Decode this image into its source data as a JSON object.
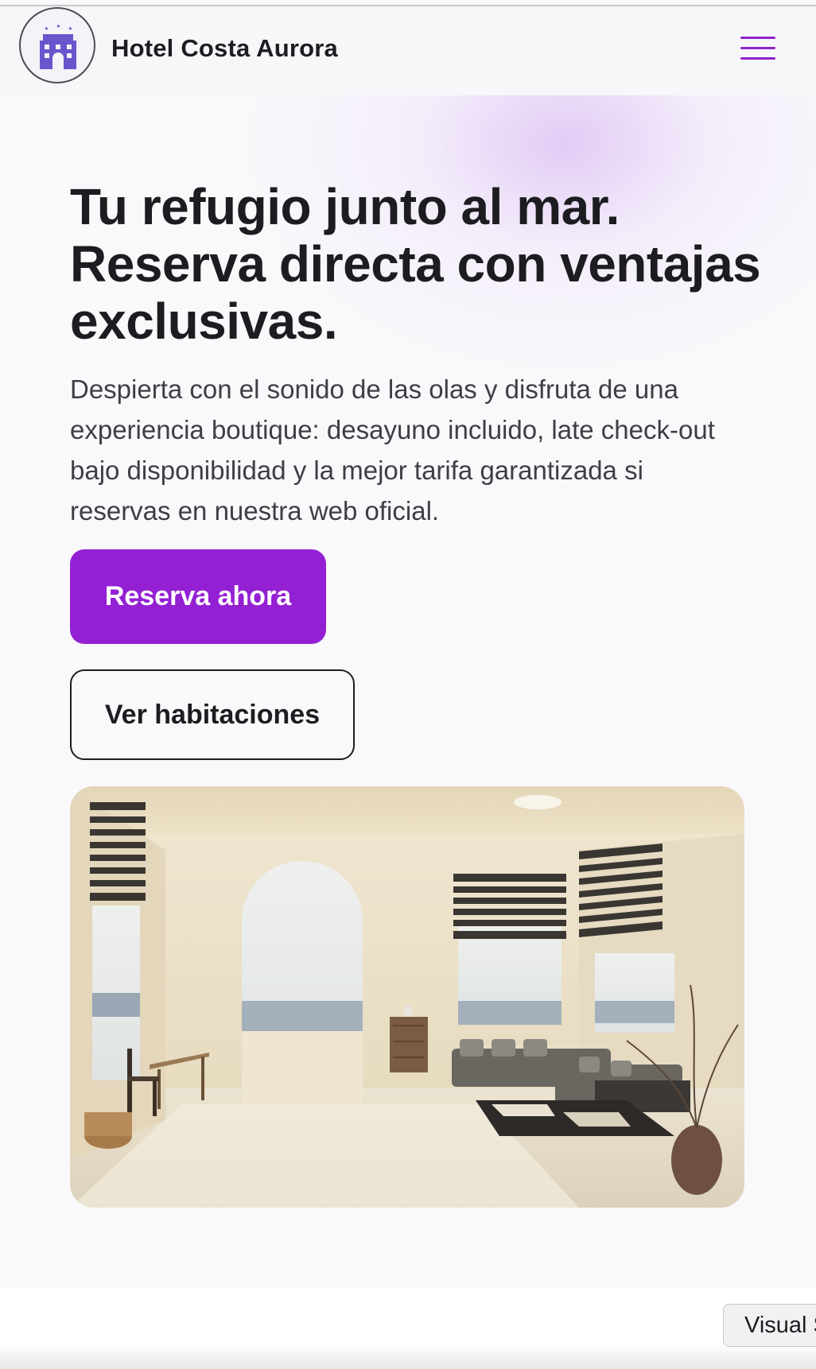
{
  "header": {
    "site_name": "Hotel Costa Aurora",
    "logo_icon": "hotel-building-icon",
    "menu_icon": "hamburger-menu-icon"
  },
  "hero": {
    "title": "Tu refugio junto al mar. Reserva directa con ventajas exclusivas.",
    "description": "Despierta con el sonido de las olas y disfruta de una experiencia boutique: desayuno incluido, late check-out bajo disponibilidad y la mejor tarifa garantizada si reservas en nuestra web oficial.",
    "primary_cta": "Reserva ahora",
    "secondary_cta": "Ver habitaciones"
  },
  "overlay": {
    "visual_tab_label": "Visual S"
  },
  "colors": {
    "accent": "#9420d4",
    "text": "#1d1d21",
    "background": "#f9f9fb"
  }
}
